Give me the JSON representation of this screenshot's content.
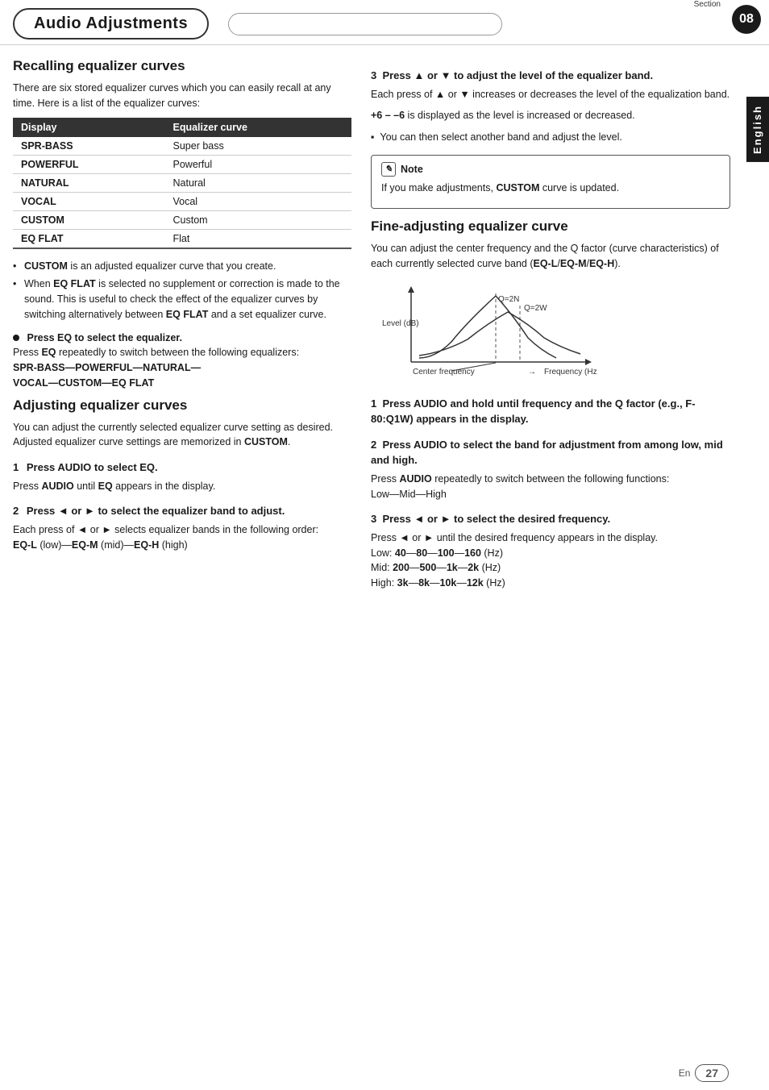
{
  "header": {
    "title": "Audio Adjustments",
    "section_label": "Section",
    "section_number": "08",
    "side_language": "English"
  },
  "left": {
    "recalling": {
      "title": "Recalling equalizer curves",
      "intro": "There are six stored equalizer curves which you can easily recall at any time. Here is a list of the equalizer curves:",
      "table": {
        "col1": "Display",
        "col2": "Equalizer curve",
        "rows": [
          {
            "display": "SPR-BASS",
            "curve": "Super bass"
          },
          {
            "display": "POWERFUL",
            "curve": "Powerful"
          },
          {
            "display": "NATURAL",
            "curve": "Natural"
          },
          {
            "display": "VOCAL",
            "curve": "Vocal"
          },
          {
            "display": "CUSTOM",
            "curve": "Custom"
          },
          {
            "display": "EQ FLAT",
            "curve": "Flat"
          }
        ]
      },
      "bullets": [
        "CUSTOM is an adjusted equalizer curve that you create.",
        "When EQ FLAT is selected no supplement or correction is made to the sound. This is useful to check the effect of the equalizer curves by switching alternatively between EQ FLAT and a set equalizer curve."
      ],
      "step_press_eq": {
        "heading": "Press EQ to select the equalizer.",
        "body": "Press EQ repeatedly to switch between the following equalizers:",
        "sequence": "SPR-BASS—POWERFUL—NATURAL—VOCAL—CUSTOM—EQ FLAT"
      }
    },
    "adjusting": {
      "title": "Adjusting equalizer curves",
      "intro": "You can adjust the currently selected equalizer curve setting as desired. Adjusted equalizer curve settings are memorized in CUSTOM.",
      "step1_heading": "1   Press AUDIO to select EQ.",
      "step1_body": "Press AUDIO until EQ appears in the display.",
      "step2_heading": "2   Press ◄ or ► to select the equalizer band to adjust.",
      "step2_body": "Each press of ◄ or ► selects equalizer bands in the following order:",
      "step2_order": "EQ-L (low)—EQ-M (mid)—EQ-H (high)"
    }
  },
  "right": {
    "step3_adjusting": {
      "heading": "3   Press ▲ or ▼ to adjust the level of the equalizer band.",
      "body1": "Each press of ▲ or ▼ increases or decreases the level of the equalization band.",
      "body2": "+6 – –6 is displayed as the level is increased or decreased.",
      "body3": "You can then select another band and adjust the level."
    },
    "note": {
      "icon": "✎",
      "title": "Note",
      "body": "If you make adjustments, CUSTOM curve is updated."
    },
    "fine_adjusting": {
      "title": "Fine-adjusting equalizer curve",
      "intro": "You can adjust the center frequency and the Q factor (curve characteristics) of each currently selected curve band (EQ-L/EQ-M/EQ-H).",
      "chart": {
        "y_label": "Level (dB)",
        "x_label": "Frequency (Hz)",
        "x_sub_label": "Center frequency",
        "q2n_label": "Q=2N",
        "q2w_label": "Q=2W"
      },
      "step1_heading": "1   Press AUDIO and hold until frequency and the Q factor (e.g., F- 80:Q1W) appears in the display.",
      "step2_heading": "2   Press AUDIO to select the band for adjustment from among low, mid and high.",
      "step2_body": "Press AUDIO repeatedly to switch between the following functions:",
      "step2_seq": "Low—Mid—High",
      "step3_heading": "3   Press ◄ or ► to select the desired frequency.",
      "step3_body": "Press ◄ or ► until the desired frequency appears in the display.",
      "freq_low": "Low: 40—80—100—160 (Hz)",
      "freq_mid": "Mid: 200—500—1k—2k (Hz)",
      "freq_high": "High: 3k—8k—10k—12k (Hz)"
    },
    "footer": {
      "en_label": "En",
      "page_number": "27"
    }
  }
}
